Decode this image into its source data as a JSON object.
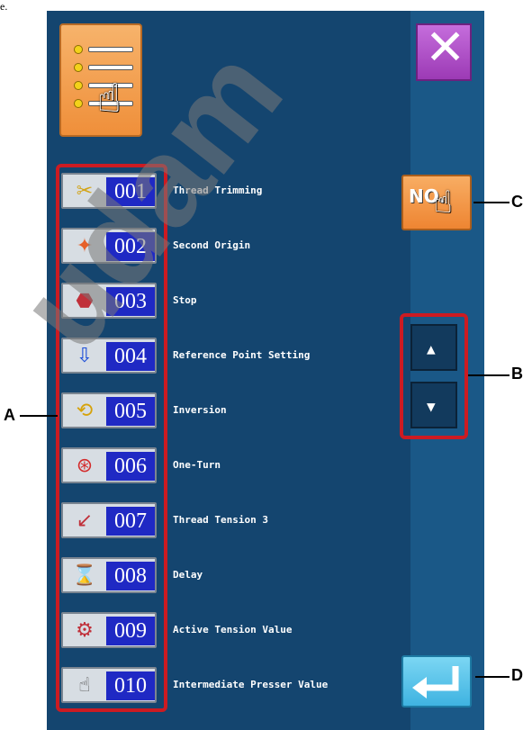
{
  "page_marker": "e.",
  "watermark_text": "udam",
  "panel": {
    "menu_icon": "list-menu-hand-icon",
    "close_icon": "close-x-icon",
    "number_button_label": "NO.",
    "scroll_up_icon": "triangle-up-icon",
    "scroll_down_icon": "triangle-down-icon",
    "enter_icon": "enter-return-icon"
  },
  "commands": [
    {
      "code": "001",
      "label": "Thread Trimming",
      "icon": "scissors-icon"
    },
    {
      "code": "002",
      "label": "Second Origin",
      "icon": "second-origin-icon"
    },
    {
      "code": "003",
      "label": "Stop",
      "icon": "stop-icon"
    },
    {
      "code": "004",
      "label": "Reference Point Setting",
      "icon": "reference-point-icon"
    },
    {
      "code": "005",
      "label": "Inversion",
      "icon": "inversion-icon"
    },
    {
      "code": "006",
      "label": "One-Turn",
      "icon": "one-turn-icon"
    },
    {
      "code": "007",
      "label": "Thread Tension 3",
      "icon": "thread-tension-icon"
    },
    {
      "code": "008",
      "label": "Delay",
      "icon": "delay-icon"
    },
    {
      "code": "009",
      "label": "Active Tension Value",
      "icon": "active-tension-icon"
    },
    {
      "code": "010",
      "label": "Intermediate Presser Value",
      "icon": "intermediate-presser-icon"
    }
  ],
  "callouts": {
    "a": "A",
    "b": "B",
    "c": "C",
    "d": "D"
  },
  "colors": {
    "screen_bg": "#14456f",
    "highlight": "#cc1b22",
    "code_bg": "#1f29c4"
  }
}
